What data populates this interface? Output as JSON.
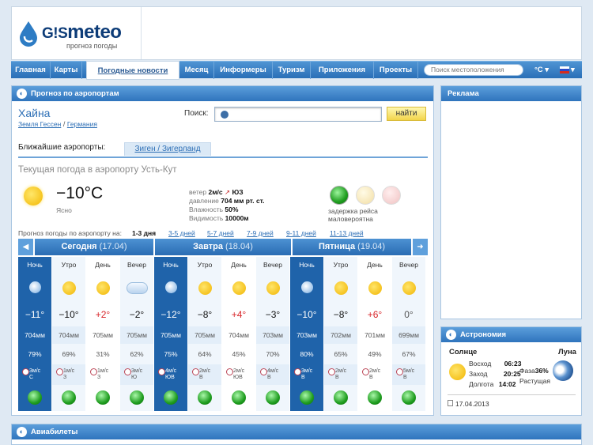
{
  "logo": {
    "brand": "meteo",
    "brand_prefix": "G!S",
    "tagline": "прогноз погоды"
  },
  "nav": {
    "items": [
      "Главная",
      "Карты",
      "Погодные новости",
      "Месяц",
      "Информеры",
      "Туризм",
      "Приложения",
      "Проекты"
    ],
    "search_placeholder": "Поиск местоположения",
    "unit": "°C ▾",
    "lang": "▾"
  },
  "main": {
    "title": "Прогноз по аэропортам",
    "city": "Хайна",
    "region": "Земля Гессен",
    "country": "Германия",
    "search_label": "Поиск:",
    "find_button": "найти",
    "nearest_label": "Ближайшие аэропорты:",
    "nearest_airport": "Зиген / Зигерланд",
    "current_title": "Текущая погода в аэропорту Усть-Кут",
    "current_temp": "−10°C",
    "current_cond": "Ясно",
    "wind_label": "ветер",
    "wind_value": "2м/с",
    "wind_dir": "ЮЗ",
    "pressure_label": "давление",
    "pressure_value": "704 мм рт. ст.",
    "humidity_label": "Влажность",
    "humidity_value": "50%",
    "visibility_label": "Видимость",
    "visibility_value": "10000м",
    "delay_line1": "задержка рейса",
    "delay_line2": "маловероятна",
    "period_label": "Прогноз погоды по аэропорту на:",
    "periods": [
      "1-3 дня",
      "3-5 дней",
      "5-7 дней",
      "7-9 дней",
      "9-11 дней",
      "11-13 дней"
    ],
    "days": [
      {
        "name": "Сегодня",
        "date": "(17.04)"
      },
      {
        "name": "Завтра",
        "date": "(18.04)"
      },
      {
        "name": "Пятница",
        "date": "(19.04)"
      }
    ],
    "arrow_left": "◀",
    "arrow_right": "➜",
    "columns": [
      {
        "h": "Ночь",
        "icon": "moon",
        "t": "−11°",
        "p": "704мм",
        "hum": "79%",
        "w1": "3м/с",
        "w2": "С",
        "night": true
      },
      {
        "h": "Утро",
        "icon": "sun",
        "t": "−10°",
        "p": "704мм",
        "hum": "69%",
        "w1": "1м/с",
        "w2": "З"
      },
      {
        "h": "День",
        "icon": "sun",
        "t": "+2°",
        "p": "705мм",
        "hum": "31%",
        "w1": "1м/с",
        "w2": "З"
      },
      {
        "h": "Вечер",
        "icon": "cloud",
        "t": "−2°",
        "p": "705мм",
        "hum": "62%",
        "w1": "3м/с",
        "w2": "Ю"
      },
      {
        "h": "Ночь",
        "icon": "moon",
        "t": "−12°",
        "p": "705мм",
        "hum": "75%",
        "w1": "4м/с",
        "w2": "ЮВ",
        "night": true
      },
      {
        "h": "Утро",
        "icon": "sun",
        "t": "−8°",
        "p": "705мм",
        "hum": "64%",
        "w1": "2м/с",
        "w2": "В"
      },
      {
        "h": "День",
        "icon": "sun",
        "t": "+4°",
        "p": "704мм",
        "hum": "45%",
        "w1": "2м/с",
        "w2": "ЮВ"
      },
      {
        "h": "Вечер",
        "icon": "sun",
        "t": "−3°",
        "p": "703мм",
        "hum": "70%",
        "w1": "4м/с",
        "w2": "В"
      },
      {
        "h": "Ночь",
        "icon": "moon",
        "t": "−10°",
        "p": "703мм",
        "hum": "80%",
        "w1": "3м/с",
        "w2": "В",
        "night": true
      },
      {
        "h": "Утро",
        "icon": "sun",
        "t": "−8°",
        "p": "702мм",
        "hum": "65%",
        "w1": "2м/с",
        "w2": "В"
      },
      {
        "h": "День",
        "icon": "sun",
        "t": "+6°",
        "p": "701мм",
        "hum": "49%",
        "w1": "2м/с",
        "w2": "В"
      },
      {
        "h": "Вечер",
        "icon": "sun",
        "t": "0°",
        "p": "699мм",
        "hum": "67%",
        "w1": "5м/с",
        "w2": "В"
      }
    ]
  },
  "ads": {
    "title": "Реклама"
  },
  "astro": {
    "title": "Астрономия",
    "sun_label": "Солнце",
    "moon_label": "Луна",
    "sunrise_label": "Восход",
    "sunrise": "06:23",
    "sunset_label": "Заход",
    "sunset": "20:25",
    "daylen_label": "Долгота",
    "daylen": "14:02",
    "phase_label": "Фаза",
    "phase": "36%",
    "moon_state": "Растущая",
    "date": "17.04.2013"
  },
  "avia": {
    "title": "Авиабилеты"
  },
  "colors": {
    "nav_blue": "#2a6fb7",
    "night_blue": "#1f63aa",
    "positive_temp": "#d8262a",
    "find_button": "#f2d44a"
  }
}
